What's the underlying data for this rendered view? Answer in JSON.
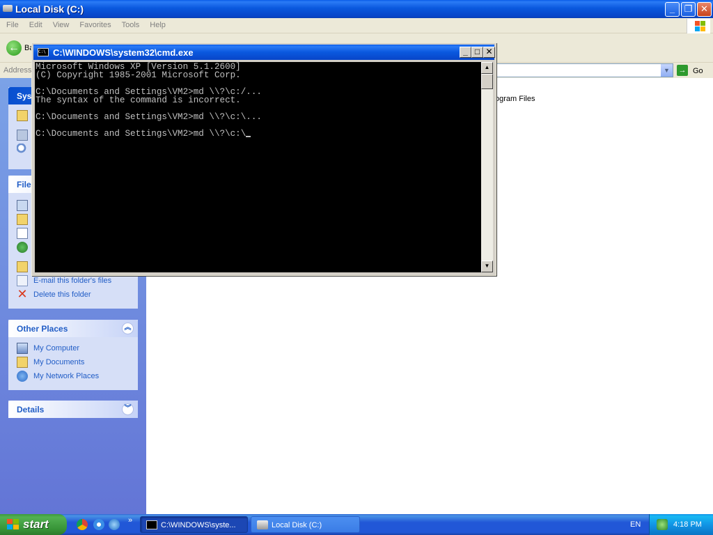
{
  "explorer": {
    "title": "Local Disk (C:)",
    "menu": [
      "File",
      "Edit",
      "View",
      "Favorites",
      "Tools",
      "Help"
    ],
    "back_label": "Ba",
    "address_label": "Address",
    "go_label": "Go",
    "folder_item": "ogram Files"
  },
  "taskpane": {
    "system_tasks_title": "Sys",
    "file_tasks_title": "File",
    "file_tasks": [
      {
        "label": "E-mail this folder's files",
        "icon": "email-icon"
      },
      {
        "label": "Delete this folder",
        "icon": "delete-icon"
      }
    ],
    "other_places_title": "Other Places",
    "other_places": [
      {
        "label": "My Computer",
        "icon": "my-computer-icon"
      },
      {
        "label": "My Documents",
        "icon": "my-documents-icon"
      },
      {
        "label": "My Network Places",
        "icon": "network-places-icon"
      }
    ],
    "details_title": "Details"
  },
  "cmd": {
    "title": "C:\\WINDOWS\\system32\\cmd.exe",
    "icon_text": "C:\\",
    "lines": [
      "Microsoft Windows XP [Version 5.1.2600]",
      "(C) Copyright 1985-2001 Microsoft Corp.",
      "",
      "C:\\Documents and Settings\\VM2>md \\\\?\\c:/...",
      "The syntax of the command is incorrect.",
      "",
      "C:\\Documents and Settings\\VM2>md \\\\?\\c:\\...",
      "",
      "C:\\Documents and Settings\\VM2>md \\\\?\\c:\\"
    ]
  },
  "taskbar": {
    "start_label": "start",
    "tasks": [
      {
        "label": "C:\\WINDOWS\\syste...",
        "active": true
      },
      {
        "label": "Local Disk (C:)",
        "active": false
      }
    ],
    "quick_more": "»",
    "language": "EN",
    "clock": "4:18 PM"
  },
  "colors": {
    "xp_blue": "#0A58DE",
    "link_blue": "#215DC6",
    "taskbar_blue": "#2157D7",
    "start_green": "#389538"
  }
}
